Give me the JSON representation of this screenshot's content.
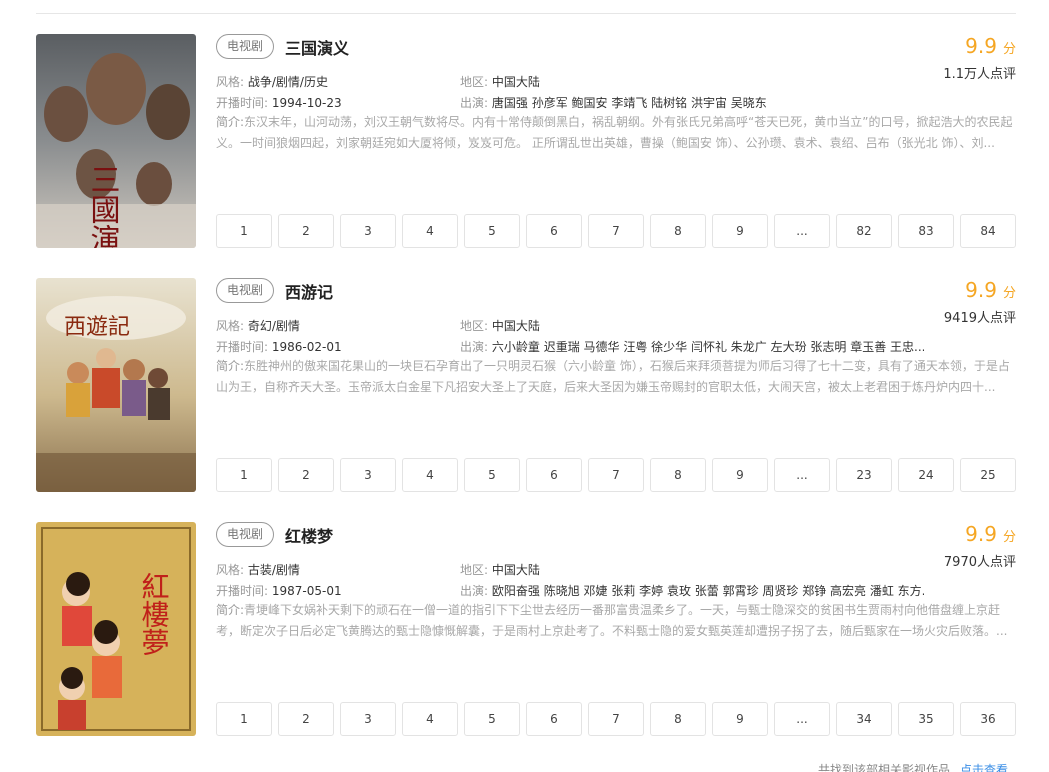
{
  "items": [
    {
      "tag": "电视剧",
      "title": "三国演义",
      "score": "9.9",
      "score_unit": "分",
      "rating_count": "1.1万人点评",
      "genre_label": "风格:",
      "genre": "战争/剧情/历史",
      "region_label": "地区:",
      "region": "中国大陆",
      "date_label": "开播时间:",
      "date": "1994-10-23",
      "cast_label": "出演:",
      "cast": "唐国强 孙彦军 鲍国安 李靖飞 陆树铭 洪宇宙 吴晓东",
      "desc_label": "简介:",
      "desc": "东汉末年，山河动荡，刘汉王朝气数将尽。内有十常侍颠倒黑白，祸乱朝纲。外有张氏兄弟高呼“苍天已死，黄巾当立”的口号，掀起浩大的农民起义。一时间狼烟四起，刘家朝廷宛如大厦将倾，岌岌可危。 正所谓乱世出英雄，曹操（鲍国安 饰）、公孙瓒、袁术、袁绍、吕布（张光北 饰）、刘...",
      "poster_text": "三國演義",
      "episodes": [
        "1",
        "2",
        "3",
        "4",
        "5",
        "6",
        "7",
        "8",
        "9",
        "...",
        "82",
        "83",
        "84"
      ]
    },
    {
      "tag": "电视剧",
      "title": "西游记",
      "score": "9.9",
      "score_unit": "分",
      "rating_count": "9419人点评",
      "genre_label": "风格:",
      "genre": "奇幻/剧情",
      "region_label": "地区:",
      "region": "中国大陆",
      "date_label": "开播时间:",
      "date": "1986-02-01",
      "cast_label": "出演:",
      "cast": "六小龄童 迟重瑞 马德华 汪粤 徐少华 闫怀礼 朱龙广 左大玢 张志明 章玉善 王忠...",
      "desc_label": "简介:",
      "desc": "东胜神州的傲来国花果山的一块巨石孕育出了一只明灵石猴（六小龄童 饰），石猴后来拜须菩提为师后习得了七十二变，具有了通天本领，于是占山为王，自称齐天大圣。玉帝派太白金星下凡招安大圣上了天庭，后来大圣因为嫌玉帝赐封的官职太低，大闹天宫，被太上老君困于炼丹炉内四十...",
      "poster_text": "西遊記",
      "episodes": [
        "1",
        "2",
        "3",
        "4",
        "5",
        "6",
        "7",
        "8",
        "9",
        "...",
        "23",
        "24",
        "25"
      ]
    },
    {
      "tag": "电视剧",
      "title": "红楼梦",
      "score": "9.9",
      "score_unit": "分",
      "rating_count": "7970人点评",
      "genre_label": "风格:",
      "genre": "古装/剧情",
      "region_label": "地区:",
      "region": "中国大陆",
      "date_label": "开播时间:",
      "date": "1987-05-01",
      "cast_label": "出演:",
      "cast": "欧阳奋强 陈晓旭 邓婕 张莉 李婷 袁玫 张蕾 郭霄珍 周贤珍 郑铮 高宏亮 潘虹 东方...",
      "desc_label": "简介:",
      "desc": "青埂峰下女娲补天剩下的顽石在一僧一道的指引下下尘世去经历一番那富贵温柔乡了。一天，与甄士隐深交的贫困书生贾雨村向他借盘缠上京赶考，断定次子日后必定飞黄腾达的甄士隐慷慨解囊，于是雨村上京赴考了。不料甄士隐的爱女甄英莲却遭拐子拐了去，随后甄家在一场火灾后败落。...",
      "poster_text": "紅樓夢",
      "episodes": [
        "1",
        "2",
        "3",
        "4",
        "5",
        "6",
        "7",
        "8",
        "9",
        "...",
        "34",
        "35",
        "36"
      ]
    }
  ],
  "footer": {
    "note": "共找到该部相关影视作品",
    "link": "点击查看"
  },
  "colors": {
    "score": "#f5a623",
    "link": "#3a8ee6"
  }
}
